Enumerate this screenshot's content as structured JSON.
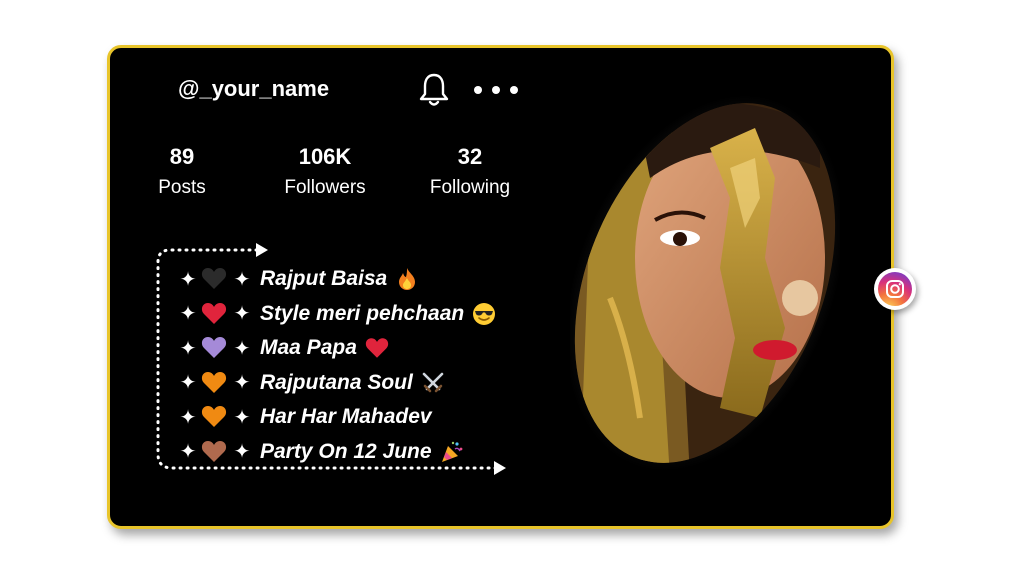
{
  "profile": {
    "username": "@_your_name",
    "stats": [
      {
        "value": "89",
        "label": "Posts"
      },
      {
        "value": "106K",
        "label": "Followers"
      },
      {
        "value": "32",
        "label": "Following"
      }
    ]
  },
  "header_icons": {
    "notifications": "bell-icon",
    "more": "more-options-icon"
  },
  "bio": {
    "sparkle": "✦",
    "lines": [
      {
        "heart_color": "#2b2b2b",
        "text": "Rajput Baisa",
        "emoji": "fire"
      },
      {
        "heart_color": "#e0243c",
        "text": "Style meri pehchaan",
        "emoji": "sunglasses-face"
      },
      {
        "heart_color": "#a58ad8",
        "text": "Maa Papa",
        "emoji": "red-heart"
      },
      {
        "heart_color": "#f08a12",
        "text": "Rajputana Soul",
        "emoji": "crossed-swords"
      },
      {
        "heart_color": "#f08a12",
        "text": "Har Har Mahadev",
        "emoji": ""
      },
      {
        "heart_color": "#b06a4e",
        "text": "Party On 12 June",
        "emoji": "party-popper"
      }
    ]
  },
  "colors": {
    "card_bg": "#000000",
    "card_border": "#e8c42a",
    "text": "#ffffff"
  },
  "side_badge": "instagram-icon"
}
